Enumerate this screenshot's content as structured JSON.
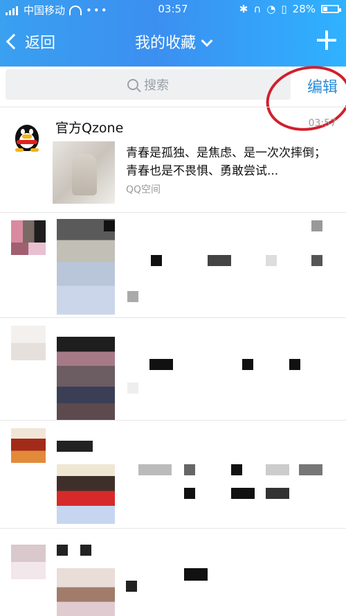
{
  "status_bar": {
    "carrier": "中国移动",
    "time": "03:57",
    "battery": "28%"
  },
  "nav": {
    "back_label": "返回",
    "title": "我的收藏",
    "plus_icon": "plus-icon"
  },
  "search": {
    "placeholder": "搜索",
    "edit_label": "编辑"
  },
  "items": [
    {
      "name": "官方Qzone",
      "time": "03:57",
      "description": "青春是孤独、是焦虑、是一次次摔倒；青春也是不畏惧、勇敢尝试...",
      "source": "QQ空间"
    }
  ],
  "colors": {
    "header_start": "#3aa0f0",
    "header_end": "#2fb2ff",
    "edit_text": "#2b8cd8",
    "circle_mark": "#d21f2c"
  }
}
